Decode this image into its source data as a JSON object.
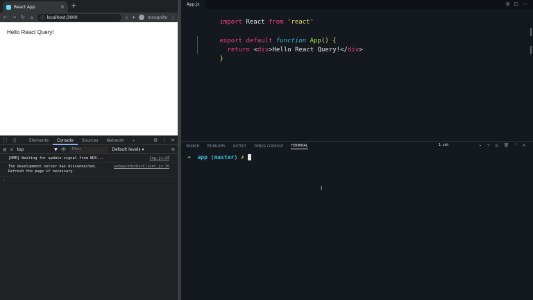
{
  "browser": {
    "tab_title": "React App",
    "tab_close": "×",
    "new_tab": "+",
    "nav": {
      "back": "←",
      "forward": "→",
      "reload": "↻",
      "home": "⌂"
    },
    "url": "localhost:3000",
    "incognito_label": "Incognito",
    "page_text": "Hello React Query!"
  },
  "devtools": {
    "tabs": [
      "Elements",
      "Console",
      "Sources",
      "Network"
    ],
    "more": "»",
    "context": "top",
    "filter_placeholder": "Filter",
    "levels": "Default levels ▾",
    "messages": [
      {
        "text": "[HMR] Waiting for update signal from WDS...",
        "source": "log.js:24"
      },
      {
        "text": "The development server has disconnected.\nRefresh the page if necessary.",
        "source": "webpackHotDevClient.js:76"
      }
    ],
    "prompt": "›"
  },
  "editor": {
    "tab": "App.js",
    "panel_tabs": [
      "SEARCH",
      "PROBLEMS",
      "OUTPUT",
      "DEBUG CONSOLE",
      "TERMINAL"
    ],
    "terminal_select": "1: zsh",
    "terminal": {
      "arrow": "➜",
      "dir": "app",
      "branch": "(master)",
      "dirty": "✗"
    }
  },
  "code": {
    "kw_import": "import",
    "name_react": "React",
    "kw_from": "from",
    "str_react": "'react'",
    "kw_export": "export",
    "kw_default": "default",
    "kw_function": "function",
    "fn_name": "App",
    "paren_brace": "() {",
    "kw_return": "return",
    "lt": "<",
    "tag_div": "div",
    "gt": ">",
    "jsx_text": "Hello React Query!",
    "close_lt": "</",
    "close_tag": "div",
    "close_gt": ">",
    "close_brace": "}"
  },
  "colors": {
    "keyword": "#f0437a",
    "function": "#3fb9d6",
    "name": "#a7e34b",
    "string": "#f2d46b",
    "editor_bg": "#14181f",
    "browser_chrome": "#202124"
  }
}
